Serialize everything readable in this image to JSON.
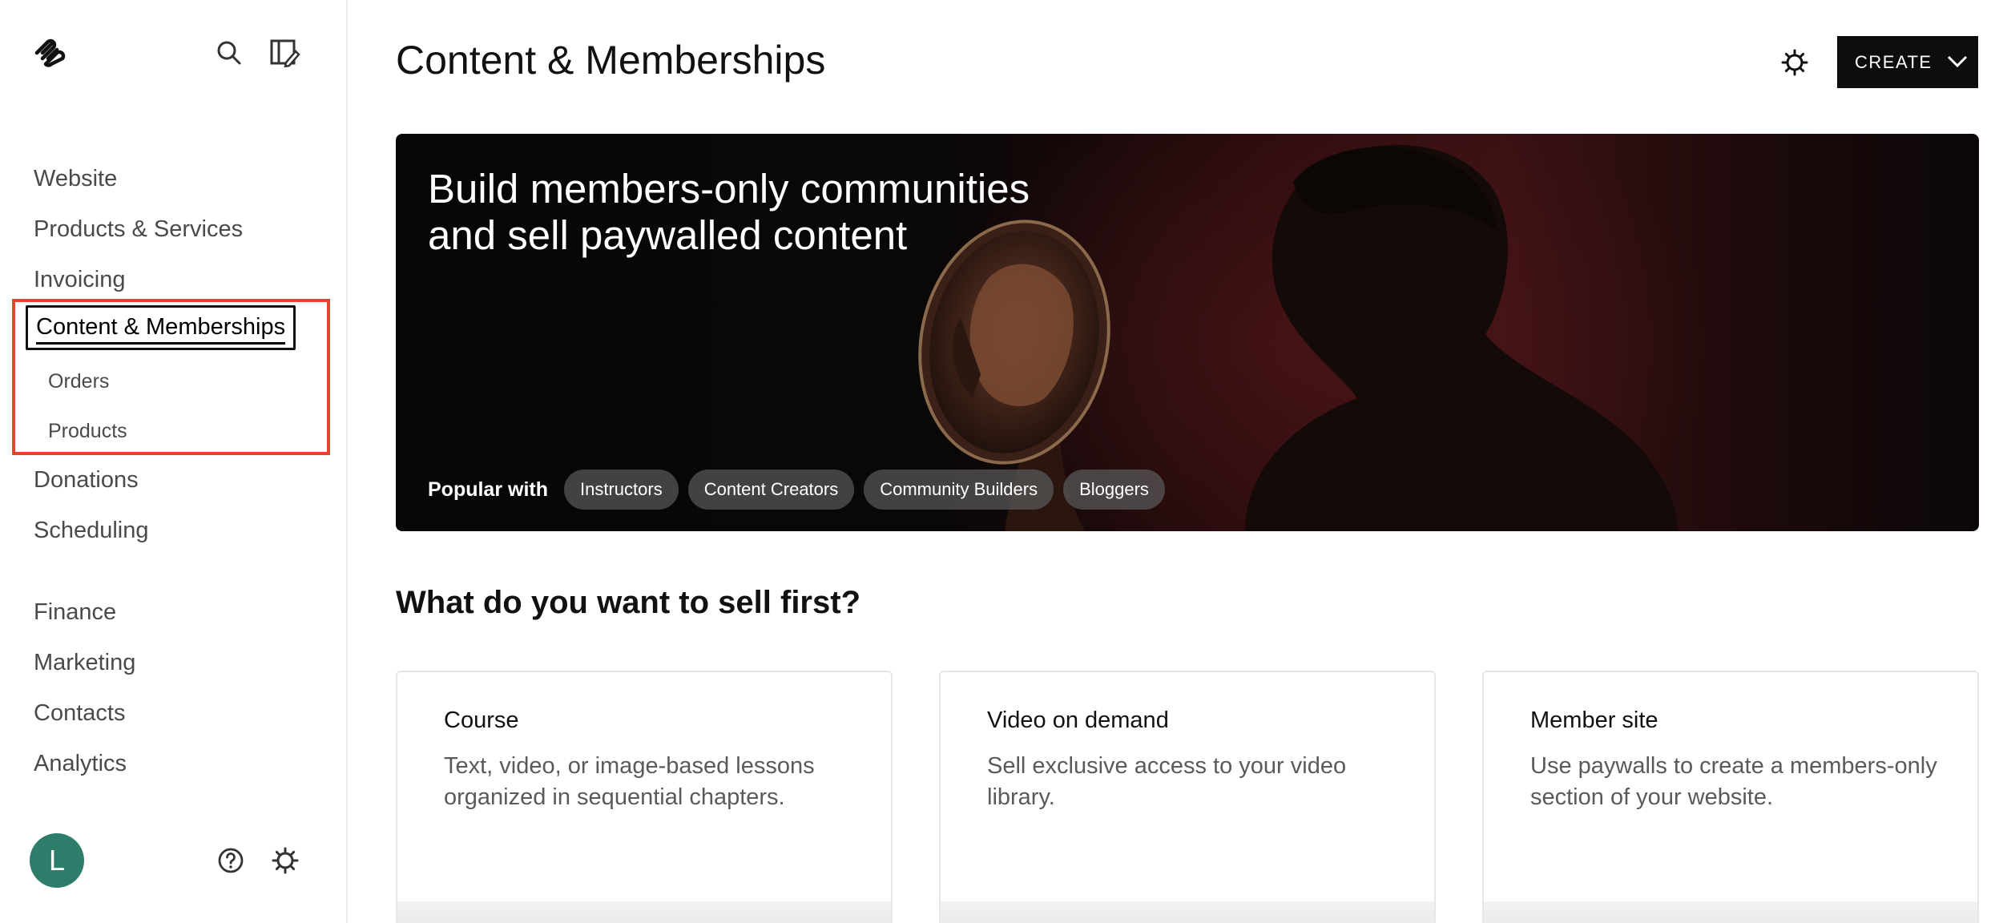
{
  "sidebar": {
    "logo_icon": "squarespace-logo-icon",
    "search_icon": "search-icon",
    "edit_icon": "edit-site-icon",
    "nav": [
      {
        "label": "Website"
      },
      {
        "label": "Products & Services"
      },
      {
        "label": "Invoicing"
      },
      {
        "label": "Content & Memberships",
        "active": true
      },
      {
        "label": "Orders",
        "sub": true
      },
      {
        "label": "Products",
        "sub": true
      },
      {
        "label": "Donations"
      },
      {
        "label": "Scheduling"
      },
      {
        "label": "Finance"
      },
      {
        "label": "Marketing"
      },
      {
        "label": "Contacts"
      },
      {
        "label": "Analytics"
      }
    ],
    "avatar_initial": "L",
    "avatar_color": "#2e7d6b",
    "help_icon": "help-icon",
    "settings_icon": "gear-icon",
    "highlight_color": "#e2462e"
  },
  "header": {
    "title": "Content & Memberships",
    "settings_icon": "gear-icon",
    "create_label": "CREATE"
  },
  "hero": {
    "title_line1": "Build members-only communities",
    "title_line2": "and sell paywalled content",
    "popular_label": "Popular with",
    "chips": [
      "Instructors",
      "Content Creators",
      "Community Builders",
      "Bloggers"
    ]
  },
  "sell": {
    "title": "What do you want to sell first?",
    "cards": [
      {
        "title": "Course",
        "desc": "Text, video, or image-based lessons organized in sequential chapters."
      },
      {
        "title": "Video on demand",
        "desc": "Sell exclusive access to your video library."
      },
      {
        "title": "Member site",
        "desc": "Use paywalls to create a members-only section of your website."
      }
    ]
  }
}
